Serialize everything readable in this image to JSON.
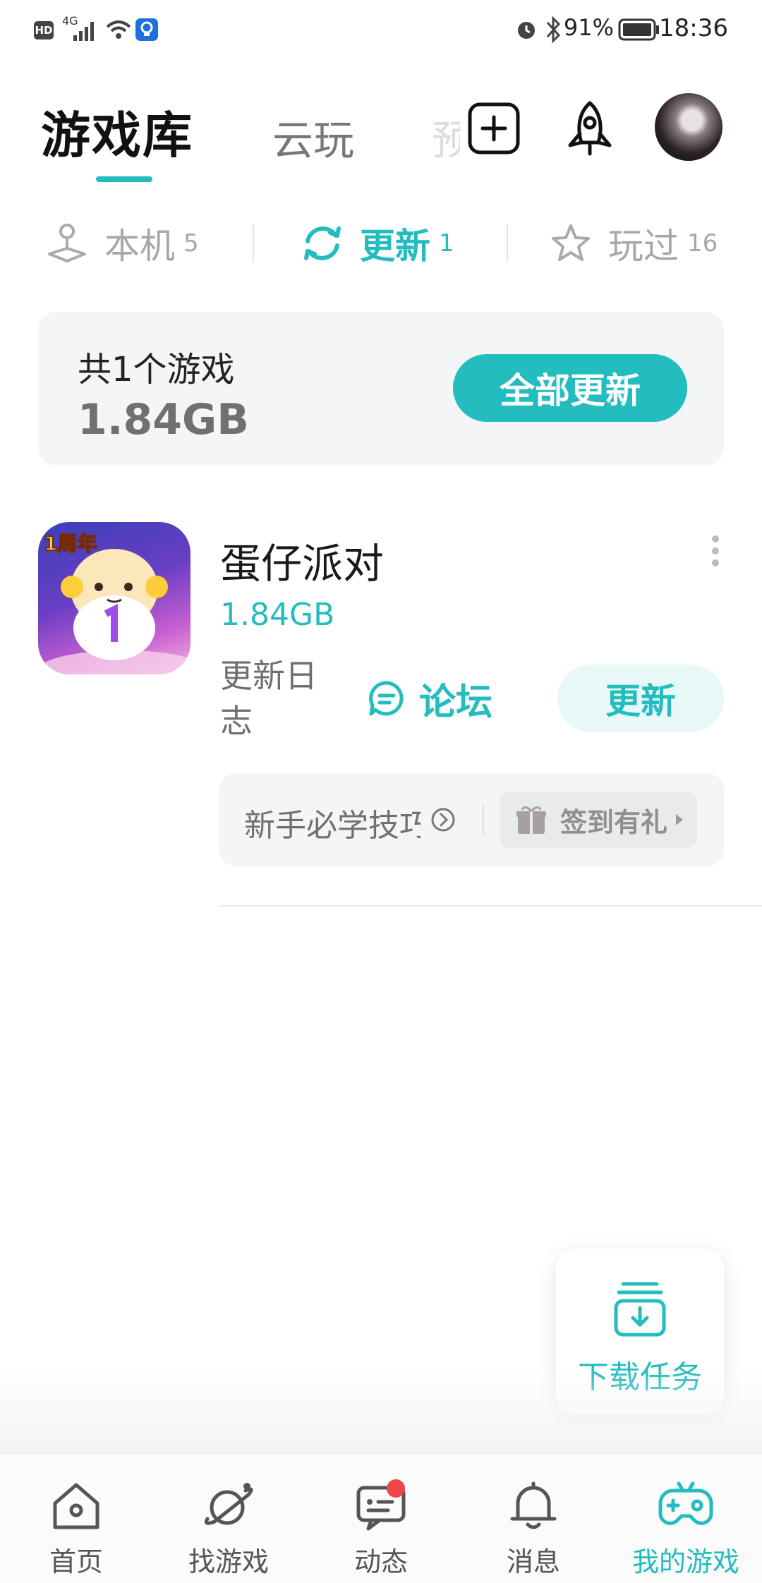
{
  "status_bar": {
    "network": "4G",
    "battery": "91%",
    "time": "18:36"
  },
  "header": {
    "tabs": [
      {
        "label": "游戏库",
        "active": true
      },
      {
        "label": "云玩",
        "active": false
      },
      {
        "label": "预",
        "active": false
      }
    ],
    "icons": [
      "add-square-icon",
      "rocket-icon",
      "avatar"
    ]
  },
  "filters": [
    {
      "icon": "joystick-icon",
      "label": "本机",
      "count": "5",
      "active": false
    },
    {
      "icon": "refresh-icon",
      "label": "更新",
      "count": "1",
      "active": true
    },
    {
      "icon": "star-icon",
      "label": "玩过",
      "count": "16",
      "active": false
    }
  ],
  "summary": {
    "count_text": "共1个游戏",
    "size": "1.84GB",
    "update_all_label": "全部更新"
  },
  "game": {
    "name": "蛋仔派对",
    "size": "1.84GB",
    "changelog_label": "更新日志",
    "forum_label": "论坛",
    "update_label": "更新",
    "tip_text": "新手必学技巧",
    "gift_label": "签到有礼",
    "icon_badge": "1周年"
  },
  "download": {
    "label": "下载任务"
  },
  "bottom_nav": [
    {
      "label": "首页",
      "icon": "home-icon",
      "active": false
    },
    {
      "label": "找游戏",
      "icon": "planet-icon",
      "active": false
    },
    {
      "label": "动态",
      "icon": "chat-icon",
      "active": false,
      "badge": true
    },
    {
      "label": "消息",
      "icon": "bell-icon",
      "active": false
    },
    {
      "label": "我的游戏",
      "icon": "gamepad-icon",
      "active": true
    }
  ],
  "colors": {
    "accent": "#23bcbf",
    "badge": "#f0454a"
  }
}
